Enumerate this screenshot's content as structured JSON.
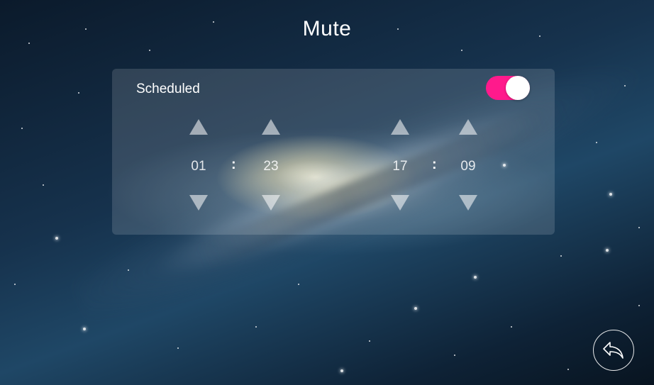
{
  "page_title": "Mute",
  "schedule": {
    "label": "Scheduled",
    "enabled": true,
    "toggle_color": "#ff1a8c",
    "start_time": {
      "hour": "01",
      "minute": "23",
      "separator": ":"
    },
    "end_time": {
      "hour": "17",
      "minute": "09",
      "separator": ":"
    }
  },
  "icons": {
    "increment": "triangle-up-icon",
    "decrement": "triangle-down-icon",
    "back": "back-arrow-icon"
  }
}
